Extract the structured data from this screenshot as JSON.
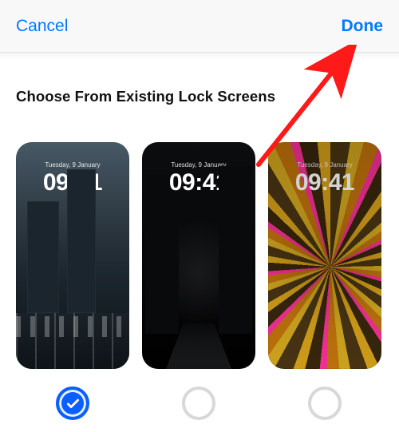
{
  "nav": {
    "cancel": "Cancel",
    "done": "Done"
  },
  "section_title": "Choose From Existing Lock Screens",
  "lockscreens": [
    {
      "date": "Tuesday, 9 January",
      "time": "09:41",
      "selected": true
    },
    {
      "date": "Tuesday, 9 January",
      "time": "09:41",
      "selected": false
    },
    {
      "date": "Tuesday, 9 January",
      "time": "09:41",
      "selected": false
    }
  ],
  "annotation": {
    "arrow_color": "#ff1a1a"
  }
}
